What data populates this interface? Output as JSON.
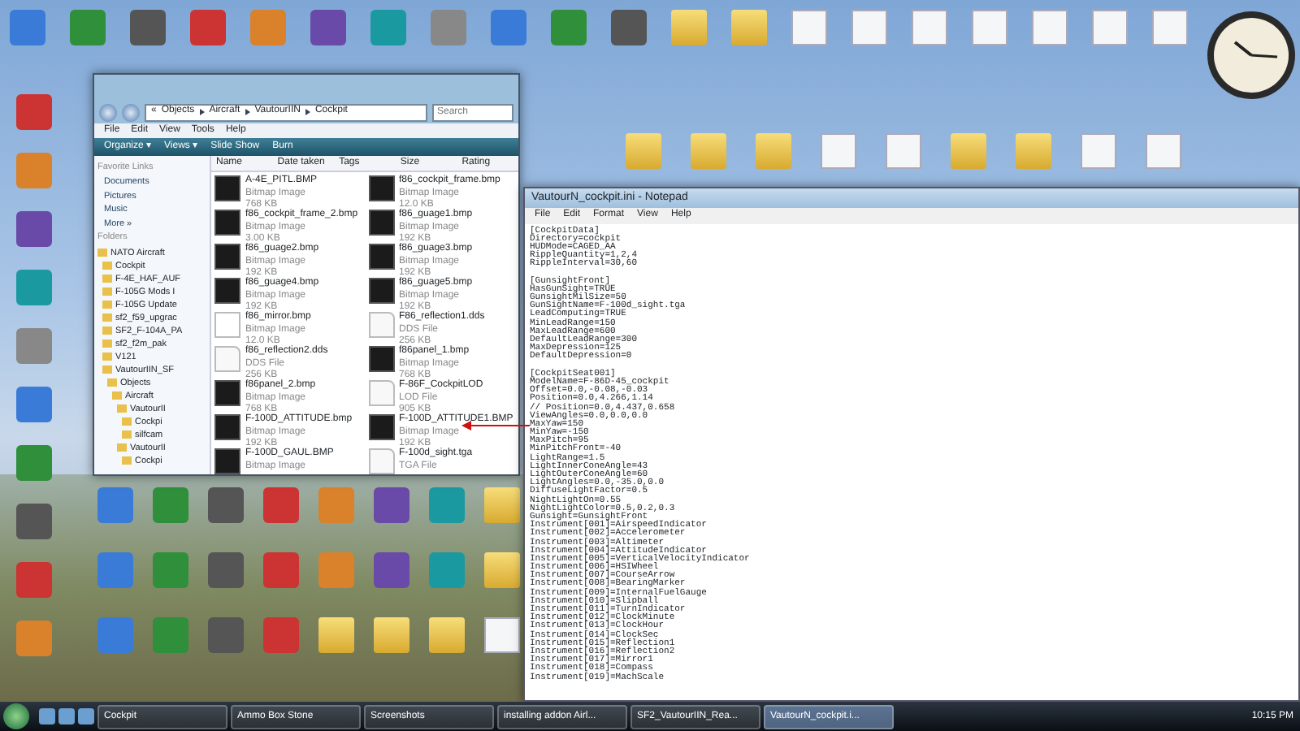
{
  "explorer": {
    "breadcrumb": [
      "«",
      "Objects",
      "Aircraft",
      "VautourIIN",
      "Cockpit"
    ],
    "search": {
      "placeholder": "Search"
    },
    "menu": [
      "File",
      "Edit",
      "View",
      "Tools",
      "Help"
    ],
    "toolbar": [
      "Organize ▾",
      "Views ▾",
      "Slide Show",
      "Burn"
    ],
    "favorites_title": "Favorite Links",
    "favorites": [
      "Documents",
      "Pictures",
      "Music",
      "More »"
    ],
    "folders_title": "Folders",
    "folders": [
      {
        "label": "NATO Aircraft",
        "children": [
          {
            "label": "Cockpit"
          },
          {
            "label": "F-4E_HAF_AUF"
          },
          {
            "label": "F-105G Mods I"
          },
          {
            "label": "F-105G Update"
          },
          {
            "label": "sf2_f59_upgrac"
          },
          {
            "label": "SF2_F-104A_PA"
          },
          {
            "label": "sf2_f2m_pak"
          },
          {
            "label": "V121"
          },
          {
            "label": "VautourIIN_SF",
            "children": [
              {
                "label": "Objects",
                "children": [
                  {
                    "label": "Aircraft",
                    "children": [
                      {
                        "label": "VautourII",
                        "children": [
                          {
                            "label": "Cockpi"
                          },
                          {
                            "label": "silfcam"
                          }
                        ]
                      },
                      {
                        "label": "VautourII",
                        "children": [
                          {
                            "label": "Cockpi"
                          }
                        ]
                      }
                    ]
                  }
                ]
              }
            ]
          }
        ]
      }
    ],
    "columns": [
      "Name",
      "Date taken",
      "Tags",
      "Size",
      "Rating"
    ],
    "files": [
      {
        "name": "A-4E_PITL.BMP",
        "type": "Bitmap Image",
        "size": "768 KB",
        "kind": "image"
      },
      {
        "name": "f86_cockpit_frame.bmp",
        "type": "Bitmap Image",
        "size": "12.0 KB",
        "kind": "image"
      },
      {
        "name": "f86_cockpit_frame_2.bmp",
        "type": "Bitmap Image",
        "size": "3.00 KB",
        "kind": "image"
      },
      {
        "name": "f86_guage1.bmp",
        "type": "Bitmap Image",
        "size": "192 KB",
        "kind": "image"
      },
      {
        "name": "f86_guage2.bmp",
        "type": "Bitmap Image",
        "size": "192 KB",
        "kind": "image"
      },
      {
        "name": "f86_guage3.bmp",
        "type": "Bitmap Image",
        "size": "192 KB",
        "kind": "image"
      },
      {
        "name": "f86_guage4.bmp",
        "type": "Bitmap Image",
        "size": "192 KB",
        "kind": "image"
      },
      {
        "name": "f86_guage5.bmp",
        "type": "Bitmap Image",
        "size": "192 KB",
        "kind": "image"
      },
      {
        "name": "f86_mirror.bmp",
        "type": "Bitmap Image",
        "size": "12.0 KB",
        "kind": "blank"
      },
      {
        "name": "F86_reflection1.dds",
        "type": "DDS File",
        "size": "256 KB",
        "kind": "document"
      },
      {
        "name": "f86_reflection2.dds",
        "type": "DDS File",
        "size": "256 KB",
        "kind": "document"
      },
      {
        "name": "f86panel_1.bmp",
        "type": "Bitmap Image",
        "size": "768 KB",
        "kind": "image"
      },
      {
        "name": "f86panel_2.bmp",
        "type": "Bitmap Image",
        "size": "768 KB",
        "kind": "image"
      },
      {
        "name": "F-86F_CockpitLOD",
        "type": "LOD File",
        "size": "905 KB",
        "kind": "document"
      },
      {
        "name": "F-100D_ATTITUDE.bmp",
        "type": "Bitmap Image",
        "size": "192 KB",
        "kind": "image"
      },
      {
        "name": "F-100D_ATTITUDE1.BMP",
        "type": "Bitmap Image",
        "size": "192 KB",
        "kind": "image"
      },
      {
        "name": "F-100D_GAUL.BMP",
        "type": "Bitmap Image",
        "kind": "image"
      },
      {
        "name": "F-100d_sight.tga",
        "type": "TGA File",
        "kind": "document"
      }
    ]
  },
  "notepad": {
    "title": "VautourN_cockpit.ini - Notepad",
    "menu": [
      "File",
      "Edit",
      "Format",
      "View",
      "Help"
    ],
    "sections": [
      [
        "[CockpitData]",
        "Directory=cockpit",
        "HUDMode=CAGED_AA",
        "RippleQuantity=1,2,4",
        "RippleInterval=30,60"
      ],
      [
        "[GunsightFront]",
        "HasGunSight=TRUE",
        "GunsightMilSize=50",
        "GunSightName=F-100d_sight.tga",
        "LeadComputing=TRUE",
        "MinLeadRange=150",
        "MaxLeadRange=600",
        "DefaultLeadRange=300",
        "MaxDepression=125",
        "DefaultDepression=0"
      ],
      [
        "[CockpitSeat001]",
        "ModelName=F-86D-45_cockpit",
        "Offset=0.0,-0.08,-0.03",
        "Position=0.0,4.266,1.14",
        "// Position=0.0,4.437,0.658",
        "ViewAngles=0.0,0.0,0.0",
        "MaxYaw=150",
        "MinYaw=-150",
        "MaxPitch=95",
        "MinPitchFront=-40",
        "LightRange=1.5",
        "LightInnerConeAngle=43",
        "LightOuterConeAngle=60",
        "LightAngles=0.0,-35.0,0.0",
        "DiffuseLightFactor=0.5",
        "NightLightOn=0.55",
        "NightLightColor=0.5,0.2,0.3",
        "Gunsight=GunsightFront",
        "Instrument[001]=AirspeedIndicator",
        "Instrument[002]=Accelerometer",
        "Instrument[003]=Altimeter",
        "Instrument[004]=AttitudeIndicator",
        "Instrument[005]=VerticalVelocityIndicator",
        "Instrument[006]=HSIWheel",
        "Instrument[007]=CourseArrow",
        "Instrument[008]=BearingMarker",
        "Instrument[009]=InternalFuelGauge",
        "Instrument[010]=Slipball",
        "Instrument[011]=TurnIndicator",
        "Instrument[012]=ClockMinute",
        "Instrument[013]=ClockHour",
        "Instrument[014]=ClockSec",
        "Instrument[015]=Reflection1",
        "Instrument[016]=Reflection2",
        "Instrument[017]=Mirror1",
        "Instrument[018]=Compass",
        "Instrument[019]=MachScale"
      ]
    ]
  },
  "taskbar": {
    "items": [
      {
        "label": "Cockpit",
        "selected": false
      },
      {
        "label": "Ammo Box Stone",
        "selected": false
      },
      {
        "label": "Screenshots",
        "selected": false
      },
      {
        "label": "installing addon Airl...",
        "selected": false
      },
      {
        "label": "SF2_VautourIIN_Rea...",
        "selected": false
      },
      {
        "label": "VautourN_cockpit.i...",
        "selected": true
      }
    ],
    "time": "10:15 PM"
  }
}
